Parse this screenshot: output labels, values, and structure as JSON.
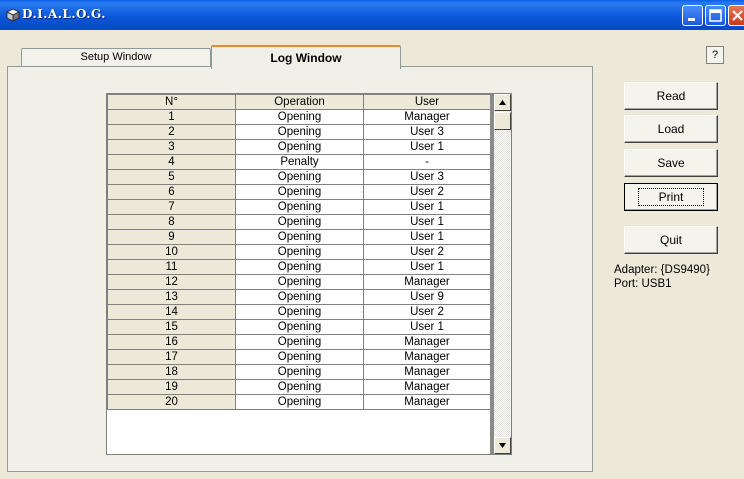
{
  "window": {
    "title": "D.I.A.L.O.G.",
    "help_label": "?"
  },
  "tabs": [
    {
      "label": "Setup Window",
      "active": false
    },
    {
      "label": "Log Window",
      "active": true
    }
  ],
  "log": {
    "columns": [
      "N°",
      "Operation",
      "User"
    ],
    "rows": [
      [
        "1",
        "Opening",
        "Manager"
      ],
      [
        "2",
        "Opening",
        "User  3"
      ],
      [
        "3",
        "Opening",
        "User  1"
      ],
      [
        "4",
        "Penalty",
        "-"
      ],
      [
        "5",
        "Opening",
        "User  3"
      ],
      [
        "6",
        "Opening",
        "User  2"
      ],
      [
        "7",
        "Opening",
        "User  1"
      ],
      [
        "8",
        "Opening",
        "User  1"
      ],
      [
        "9",
        "Opening",
        "User  1"
      ],
      [
        "10",
        "Opening",
        "User  2"
      ],
      [
        "11",
        "Opening",
        "User  1"
      ],
      [
        "12",
        "Opening",
        "Manager"
      ],
      [
        "13",
        "Opening",
        "User  9"
      ],
      [
        "14",
        "Opening",
        "User  2"
      ],
      [
        "15",
        "Opening",
        "User  1"
      ],
      [
        "16",
        "Opening",
        "Manager"
      ],
      [
        "17",
        "Opening",
        "Manager"
      ],
      [
        "18",
        "Opening",
        "Manager"
      ],
      [
        "19",
        "Opening",
        "Manager"
      ],
      [
        "20",
        "Opening",
        "Manager"
      ]
    ]
  },
  "buttons": {
    "read": "Read",
    "load": "Load",
    "save": "Save",
    "print": "Print",
    "quit": "Quit"
  },
  "device": {
    "adapter": "Adapter: {DS9490}",
    "port": "Port: USB1"
  },
  "colors": {
    "titlebar": "#0b57d8",
    "face": "#ece9d8",
    "active_tab_accent": "#e68b2c"
  }
}
